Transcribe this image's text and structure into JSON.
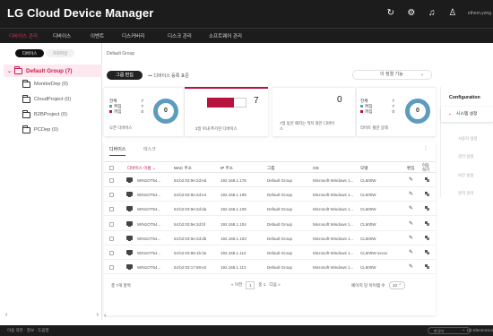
{
  "app": {
    "title": "LG Cloud Device Manager",
    "user": "ethem.yong"
  },
  "header": {
    "icons": [
      "refresh-icon",
      "gear-icon",
      "bell-icon",
      "user-icon"
    ]
  },
  "menu": [
    {
      "label": "디바이스 관리",
      "active": true
    },
    {
      "label": "디바이스",
      "active": false
    },
    {
      "label": "이벤트",
      "active": false
    },
    {
      "label": "디스커버리",
      "active": false
    },
    {
      "label": "디스크 관리",
      "active": false
    },
    {
      "label": "소프트웨어 관리",
      "active": false
    }
  ],
  "sidebar": {
    "tabs": [
      "디바이스",
      "프로파일"
    ],
    "root": "Default Group (7)",
    "items": [
      "MonitorDep (0)",
      "CloudProject (0)",
      "B2BProject (0)",
      "PCDep (0)"
    ]
  },
  "breadcrumb": "Default Group",
  "toolbar": {
    "group_edit": "그룹 편집",
    "add_device": "디바이스 등록 표준",
    "sort": "이 정렬 기능"
  },
  "cards": {
    "status": {
      "total_label": "전체",
      "total": "7",
      "on_label": "켜짐",
      "on": "7",
      "off_label": "꺼짐",
      "off": "0",
      "center": "0",
      "caption": "오픈 디바이스"
    },
    "new": {
      "value": "7",
      "caption": "3일 이내 추가된 디바이스",
      "fill": 1.0
    },
    "stale": {
      "value": "0",
      "caption": "7일 동안 패치는 적지 않은 디바이스"
    },
    "agent": {
      "total_label": "전체",
      "total": "7",
      "on_label": "켜짐",
      "on": "7",
      "off_label": "꺼짐",
      "off": "0",
      "center": "0",
      "caption": "라이트 될만 상태"
    }
  },
  "config": {
    "title": "Configuration",
    "selected": "시스템 설정",
    "items": [
      "사용자 설정",
      "관리 설정",
      "보안 설정",
      "원격 관리"
    ]
  },
  "table": {
    "tabs": [
      "디바이스",
      "태스크"
    ],
    "headers": {
      "name": "디바이스 이름",
      "mac": "MAC 주소",
      "ip": "IP 주소",
      "group": "그룹",
      "os": "OS",
      "model": "모델",
      "edit": "편집",
      "move": "이동하기"
    },
    "rows": [
      {
        "name": "WIN1OT54...",
        "mac": "54:b2:03:9e:2d:ed",
        "ip": "192.168.1.178",
        "group": "Default Group",
        "os": "Microsoft Windows 1...",
        "model": "CL600W"
      },
      {
        "name": "WIN1OT54...",
        "mac": "54:b2:03:9e:2d:e4",
        "ip": "192.168.1.108",
        "group": "Default Group",
        "os": "Microsoft Windows 1...",
        "model": "CL600W"
      },
      {
        "name": "WIN1OT54...",
        "mac": "54:b2:03:9e:2d:da",
        "ip": "192.168.1.109",
        "group": "Default Group",
        "os": "Microsoft Windows 1...",
        "model": "CL600W"
      },
      {
        "name": "WIN1OT54...",
        "mac": "54:b2:03:9e:2d:bf",
        "ip": "192.168.1.104",
        "group": "Default Group",
        "os": "Microsoft Windows 1...",
        "model": "CL600W"
      },
      {
        "name": "WIN1OT54...",
        "mac": "54:b2:03:9e:2d:db",
        "ip": "192.168.1.103",
        "group": "Default Group",
        "os": "Microsoft Windows 1...",
        "model": "CL600W"
      },
      {
        "name": "WIN1OT54...",
        "mac": "54:b2:03:86:1b:3e",
        "ip": "192.168.1.112",
        "group": "Default Group",
        "os": "Microsoft Windows 1...",
        "model": "CL600W-xxxxx"
      },
      {
        "name": "WIN1OT54...",
        "mac": "54:b2:03:17:69:e2",
        "ip": "192.168.1.113",
        "group": "Default Group",
        "os": "Microsoft Windows 1...",
        "model": "CL600W"
      }
    ],
    "footer": {
      "total": "총 7개 항목",
      "prev": "이전",
      "page": "1",
      "of": "중 1",
      "next": "다음",
      "rpp_label": "페이지 당 아이템 수",
      "rpp": "10"
    }
  },
  "bottom": {
    "links": "이용 약관 · 정보 · 도움말",
    "lang": "한국어",
    "brand": "LG Electronics"
  }
}
